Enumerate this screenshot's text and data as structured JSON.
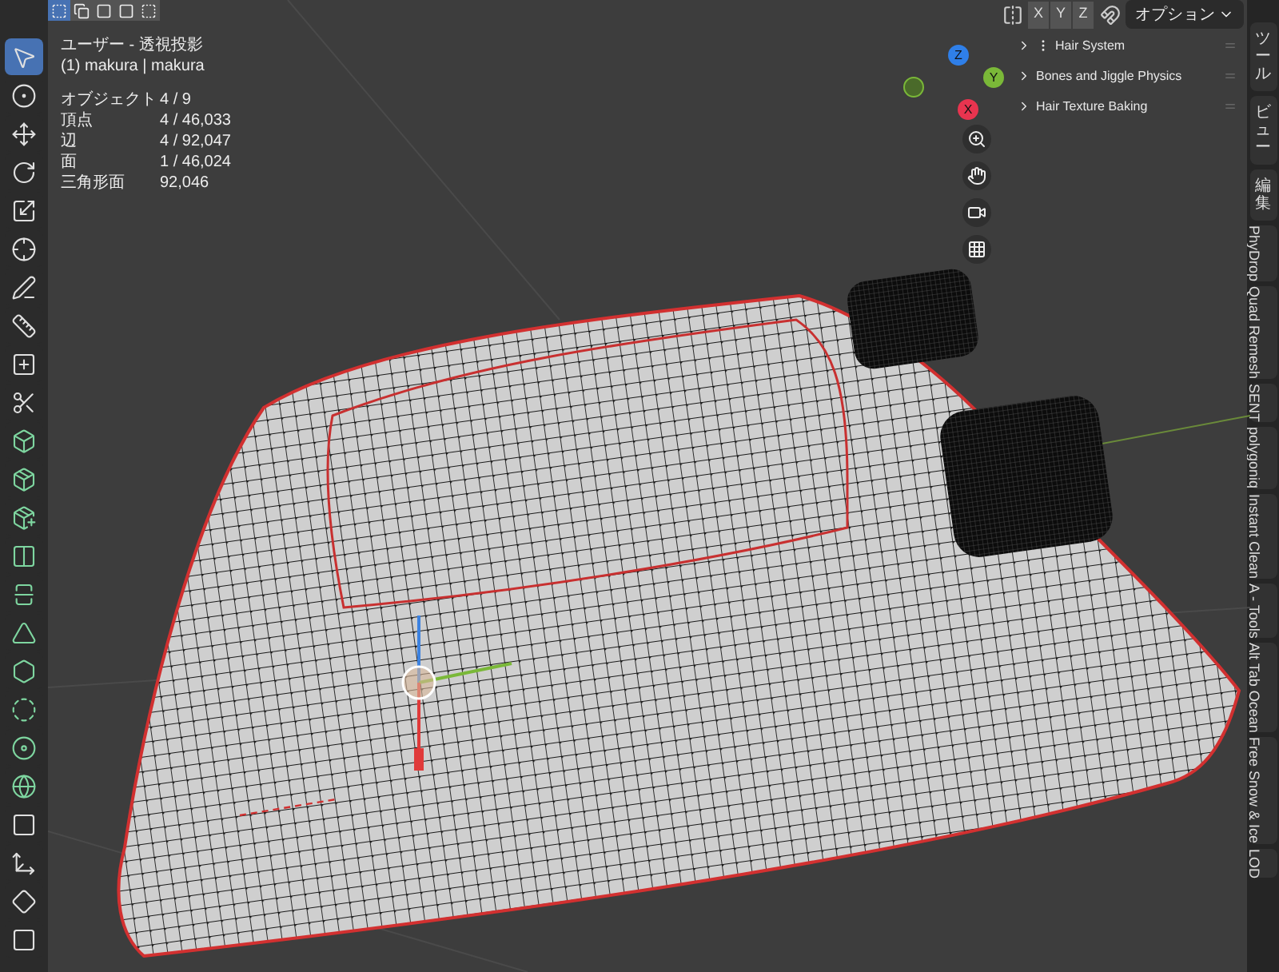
{
  "viewport_header": {
    "select_modes": [
      {
        "selected": true
      },
      {
        "selected": false
      },
      {
        "selected": false
      },
      {
        "selected": false
      },
      {
        "selected": false
      }
    ],
    "axis_toggles": [
      "X",
      "Y",
      "Z"
    ],
    "options_menu": "オプション"
  },
  "toolbar": {
    "tools": [
      {
        "selected": true
      },
      {
        "selected": false
      },
      {
        "selected": false
      },
      {
        "selected": false
      },
      {
        "selected": false
      },
      {
        "selected": false
      },
      {
        "selected": false
      },
      {
        "selected": false
      },
      {
        "selected": false
      },
      {
        "selected": false
      },
      {
        "selected": false
      },
      {
        "selected": false
      },
      {
        "selected": false
      },
      {
        "selected": false
      },
      {
        "selected": false
      },
      {
        "selected": false
      },
      {
        "selected": false
      },
      {
        "selected": false
      },
      {
        "selected": false
      },
      {
        "selected": false
      },
      {
        "selected": false
      },
      {
        "selected": false
      },
      {
        "selected": false
      },
      {
        "selected": false
      }
    ]
  },
  "overlay": {
    "view_title": "ユーザー - 透視投影",
    "object_name": "(1) makura | makura",
    "stats": [
      {
        "label": "オブジェクト",
        "value": "4 / 9"
      },
      {
        "label": "頂点",
        "value": "4 / 46,033"
      },
      {
        "label": "辺",
        "value": "4 / 92,047"
      },
      {
        "label": "面",
        "value": "1 / 46,024"
      },
      {
        "label": "三角形面",
        "value": "92,046"
      }
    ]
  },
  "gizmo": {
    "axes": [
      {
        "label": "Z",
        "color": "#2f7fe8"
      },
      {
        "label": "Y",
        "color": "#7ab838"
      },
      {
        "label": "X",
        "color": "#e8344f"
      }
    ]
  },
  "sidebar": {
    "panels": [
      {
        "title": "Hair System",
        "expanded": false,
        "has_handle": true
      },
      {
        "title": "Bones and Jiggle Physics",
        "expanded": false,
        "has_handle": false
      },
      {
        "title": "Hair Texture Baking",
        "expanded": false,
        "has_handle": false
      }
    ],
    "tabs": [
      {
        "label": "ツール",
        "kind": "stacked"
      },
      {
        "label": "ビュー",
        "kind": "stacked"
      },
      {
        "label": "編集",
        "kind": "stacked"
      },
      {
        "label": "PhyDrop",
        "kind": "rotated"
      },
      {
        "label": "Quad Remesh",
        "kind": "rotated"
      },
      {
        "label": "SENT",
        "kind": "rotated"
      },
      {
        "label": "polygoniq",
        "kind": "rotated"
      },
      {
        "label": "Instant Clean",
        "kind": "rotated"
      },
      {
        "label": "A - Tools",
        "kind": "rotated"
      },
      {
        "label": "Alt Tab Ocean",
        "kind": "rotated"
      },
      {
        "label": "Free Snow & Ice",
        "kind": "rotated"
      },
      {
        "label": "LOD",
        "kind": "rotated"
      }
    ]
  }
}
